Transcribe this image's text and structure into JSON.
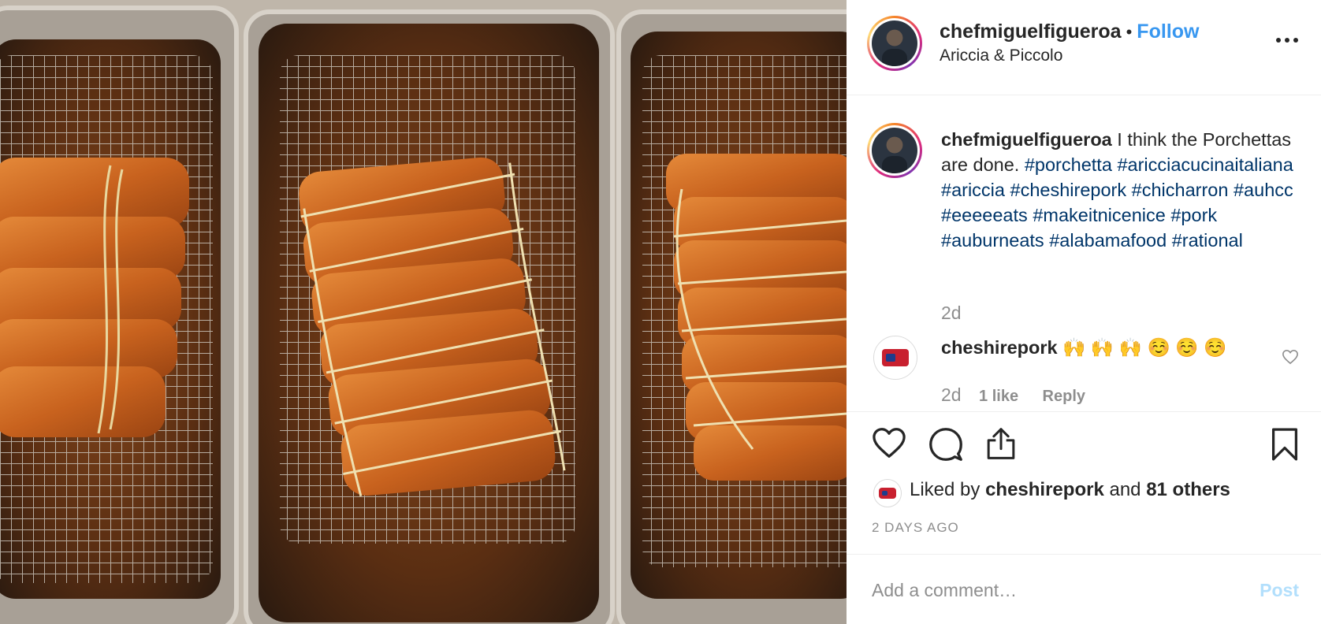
{
  "post": {
    "username": "chefmiguelfigueroa",
    "separator": "•",
    "follow_label": "Follow",
    "location": "Ariccia & Piccolo",
    "more_label": "•••"
  },
  "caption": {
    "username": "chefmiguelfigueroa",
    "text": "I think the Porchettas are done.",
    "hashtags": [
      "#porchetta",
      "#aricciacucinaitaliana",
      "#ariccia",
      "#cheshirepork",
      "#chicharron",
      "#auhcc",
      "#eeeeeats",
      "#makeitnicenice",
      "#pork",
      "#auburneats",
      "#alabamafood",
      "#rational"
    ],
    "time": "2d"
  },
  "comment": {
    "username": "cheshirepork",
    "text": "🙌 🙌 🙌 ☺️ ☺️ ☺️",
    "time": "2d",
    "likes": "1 like",
    "reply_label": "Reply"
  },
  "likes": {
    "prefix": "Liked by",
    "user": "cheshirepork",
    "conjunction": "and",
    "others": "81 others"
  },
  "timestamp": "2 DAYS AGO",
  "comment_box": {
    "placeholder": "Add a comment…",
    "post_label": "Post"
  },
  "colors": {
    "link_blue": "#3897f0",
    "hashtag": "#003569",
    "muted": "#8e8e8e",
    "post_disabled": "#b2dffc"
  },
  "icons": [
    "heart-icon",
    "comment-icon",
    "share-icon",
    "bookmark-icon",
    "more-icon",
    "comment-like-icon"
  ],
  "image": {
    "subject": "three trays of roasted porchetta on wire racks"
  }
}
